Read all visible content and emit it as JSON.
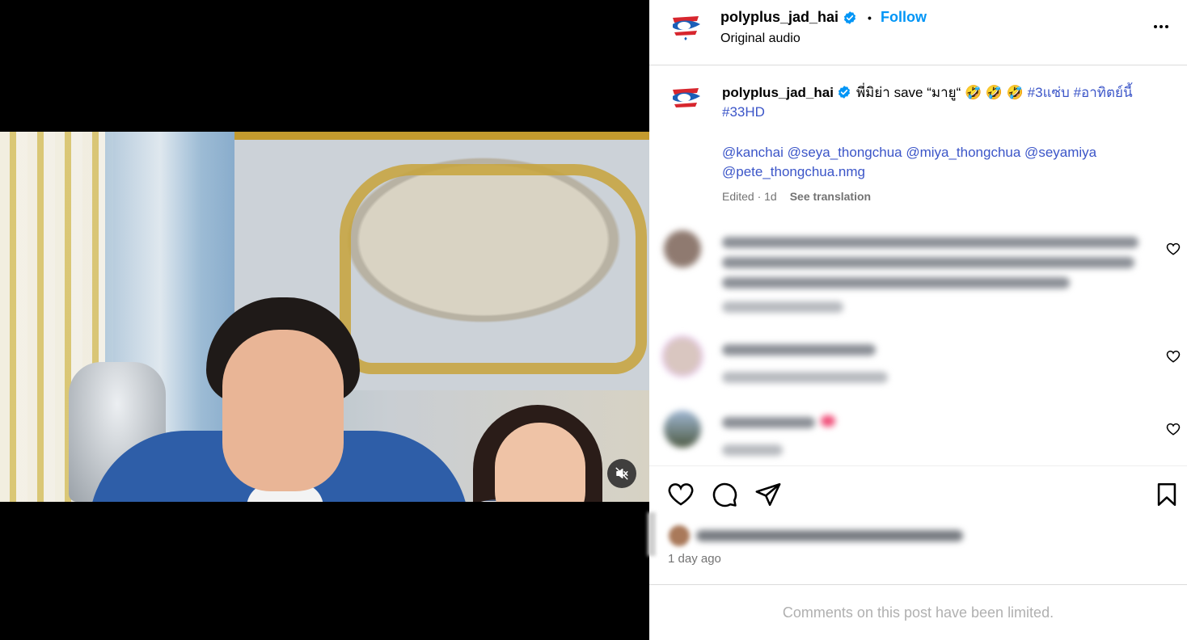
{
  "header": {
    "username": "polyplus_jad_hai",
    "follow_label": "Follow",
    "separator": "•",
    "subtitle": "Original audio"
  },
  "caption": {
    "username": "polyplus_jad_hai",
    "text": "พี่มิย่า save “มายู“ 🤣 🤣 🤣",
    "hashtags": [
      "#3แซ่บ",
      "#อาทิตย์นี้",
      "#33HD"
    ],
    "mentions": "@kanchai @seya_thongchua @miya_thongchua @seyamiya @pete_thongchua.nmg",
    "meta": "Edited · 1d",
    "see_translation": "See translation"
  },
  "footer": {
    "time_ago": "1 day ago",
    "limited_notice": "Comments on this post have been limited."
  },
  "colors": {
    "link": "#0095f6",
    "tag": "#3b55c8",
    "muted": "#737373"
  },
  "icons": {
    "mute": "speaker-muted-icon",
    "like": "heart-icon",
    "comment": "comment-bubble-icon",
    "share": "paper-plane-icon",
    "save": "bookmark-icon",
    "verified": "verified-badge-icon",
    "more": "more-options-icon"
  }
}
